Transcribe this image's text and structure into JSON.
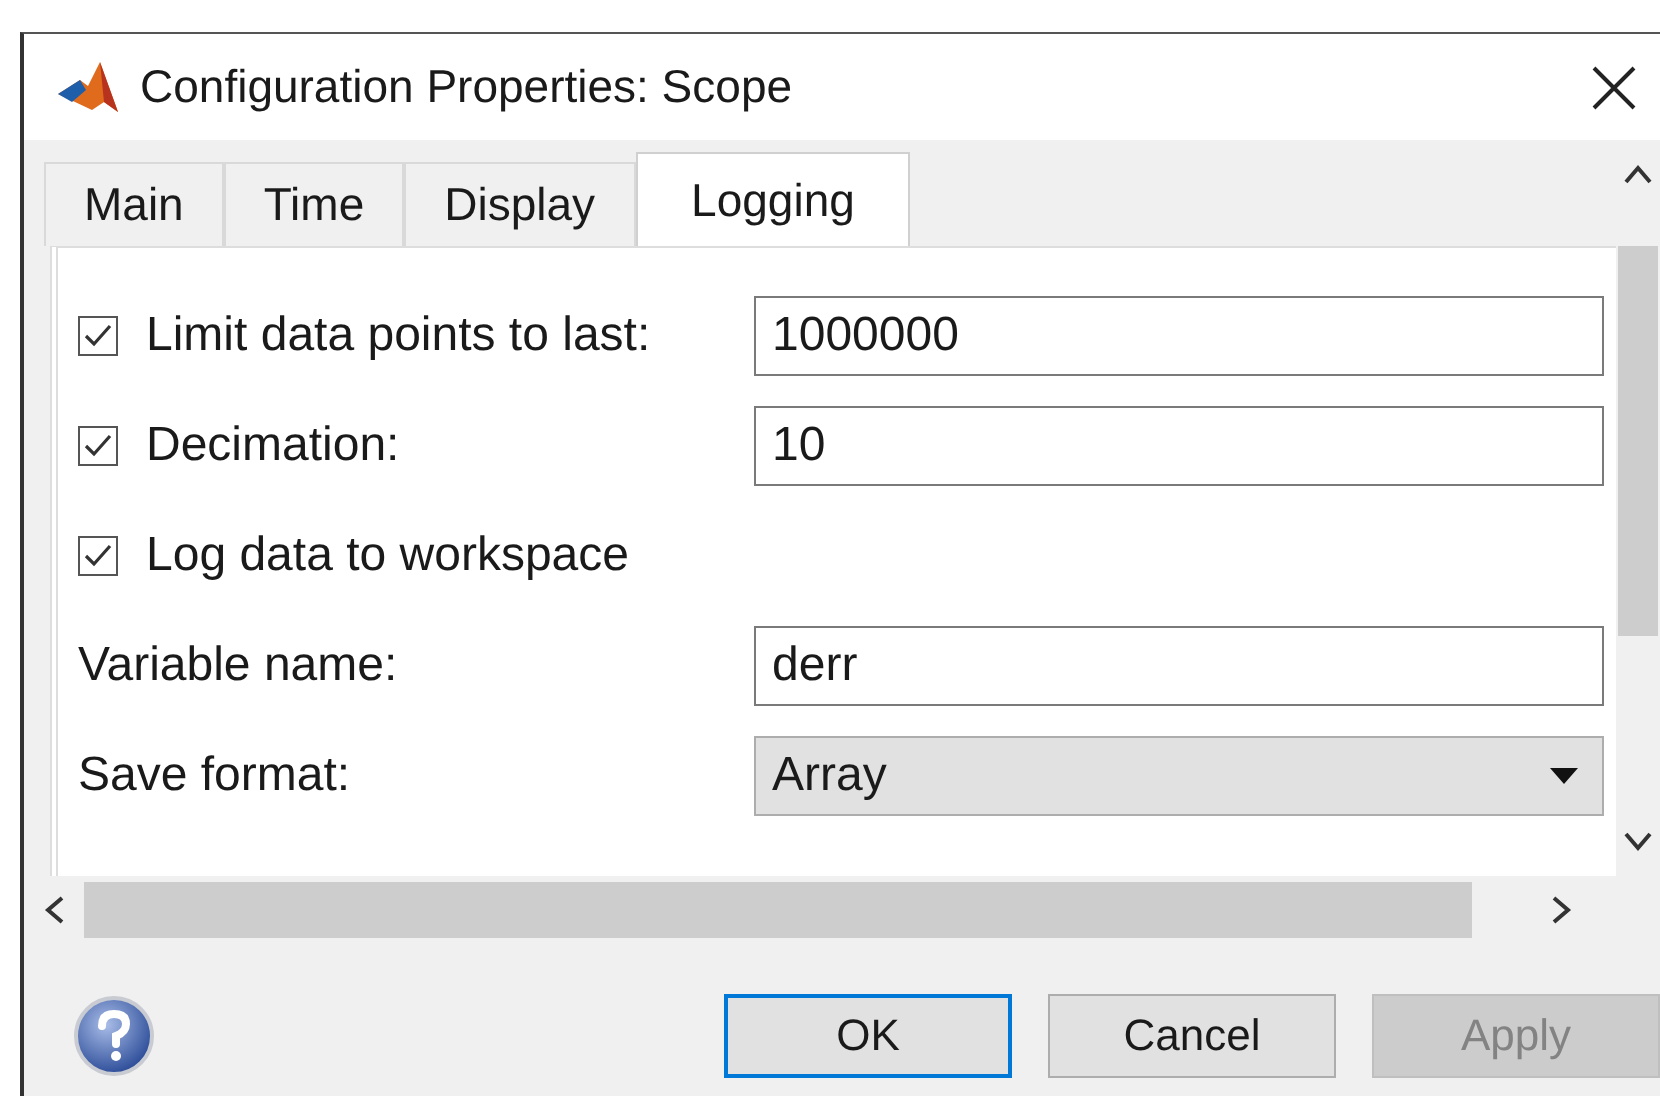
{
  "window": {
    "title": "Configuration Properties: Scope"
  },
  "tabs": [
    {
      "label": "Main",
      "selected": false
    },
    {
      "label": "Time",
      "selected": false
    },
    {
      "label": "Display",
      "selected": false
    },
    {
      "label": "Logging",
      "selected": true
    }
  ],
  "rows": [
    {
      "kind": "checkbox",
      "label": "Limit data points to last:",
      "checked": true,
      "value": "1000000"
    },
    {
      "kind": "checkbox",
      "label": "Decimation:",
      "checked": true,
      "value": "10"
    },
    {
      "kind": "checkbox",
      "label": "Log data to workspace",
      "checked": true
    },
    {
      "kind": "field",
      "label": "Variable name:",
      "value": "derr"
    },
    {
      "kind": "dropdown",
      "label": "Save format:",
      "value": "Array"
    }
  ],
  "buttons": [
    {
      "label": "OK",
      "default": true,
      "disabled": false
    },
    {
      "label": "Cancel",
      "default": false,
      "disabled": false
    },
    {
      "label": "Apply",
      "default": false,
      "disabled": true
    }
  ]
}
